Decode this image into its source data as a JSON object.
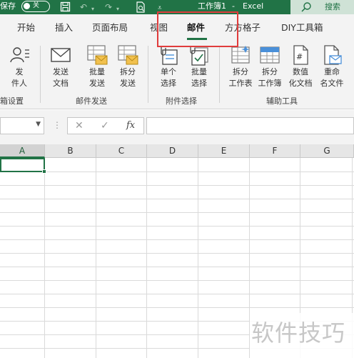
{
  "title_bar": {
    "autosave_label": "保存",
    "toggle_state": "关",
    "doc_title": "工作簿1",
    "separator": "-",
    "app_name": "Excel",
    "search_label": "搜索"
  },
  "tabs": [
    {
      "label": "开始"
    },
    {
      "label": "插入"
    },
    {
      "label": "页面布局"
    },
    {
      "label": "视图"
    },
    {
      "label": "邮件",
      "active": true
    },
    {
      "label": "方方格子"
    },
    {
      "label": "DIY工具箱"
    }
  ],
  "ribbon": {
    "buttons": [
      {
        "label1": "发",
        "label2": "件人",
        "icon": "sender-icon"
      },
      {
        "label1": "发送",
        "label2": "文档",
        "icon": "envelope-icon"
      },
      {
        "label1": "批量",
        "label2": "发送",
        "icon": "batch-send-icon"
      },
      {
        "label1": "拆分",
        "label2": "发送",
        "icon": "split-send-icon"
      },
      {
        "label1": "单个",
        "label2": "选择",
        "icon": "single-attach-icon"
      },
      {
        "label1": "批量",
        "label2": "选择",
        "icon": "batch-attach-icon"
      },
      {
        "label1": "拆分",
        "label2": "工作表",
        "icon": "split-sheet-icon"
      },
      {
        "label1": "拆分",
        "label2": "工作簿",
        "icon": "split-workbook-icon"
      },
      {
        "label1": "数值",
        "label2": "化文档",
        "icon": "numeric-doc-icon"
      },
      {
        "label1": "重命",
        "label2": "名文件",
        "icon": "rename-file-icon"
      }
    ],
    "groups": [
      {
        "label": "箱设置"
      },
      {
        "label": "邮件发送"
      },
      {
        "label": "附件选择"
      },
      {
        "label": "辅助工具"
      }
    ]
  },
  "formula_bar": {
    "name_box_value": "",
    "cancel_symbol": "✕",
    "enter_symbol": "✓",
    "fx_symbol": "fx",
    "formula_value": ""
  },
  "grid": {
    "columns": [
      "A",
      "B",
      "C",
      "D",
      "E",
      "F",
      "G"
    ],
    "selected_cell": "A1"
  },
  "watermark": {
    "text": "软件技巧"
  },
  "colors": {
    "accent": "#217346",
    "highlight": "#e03c3c"
  }
}
